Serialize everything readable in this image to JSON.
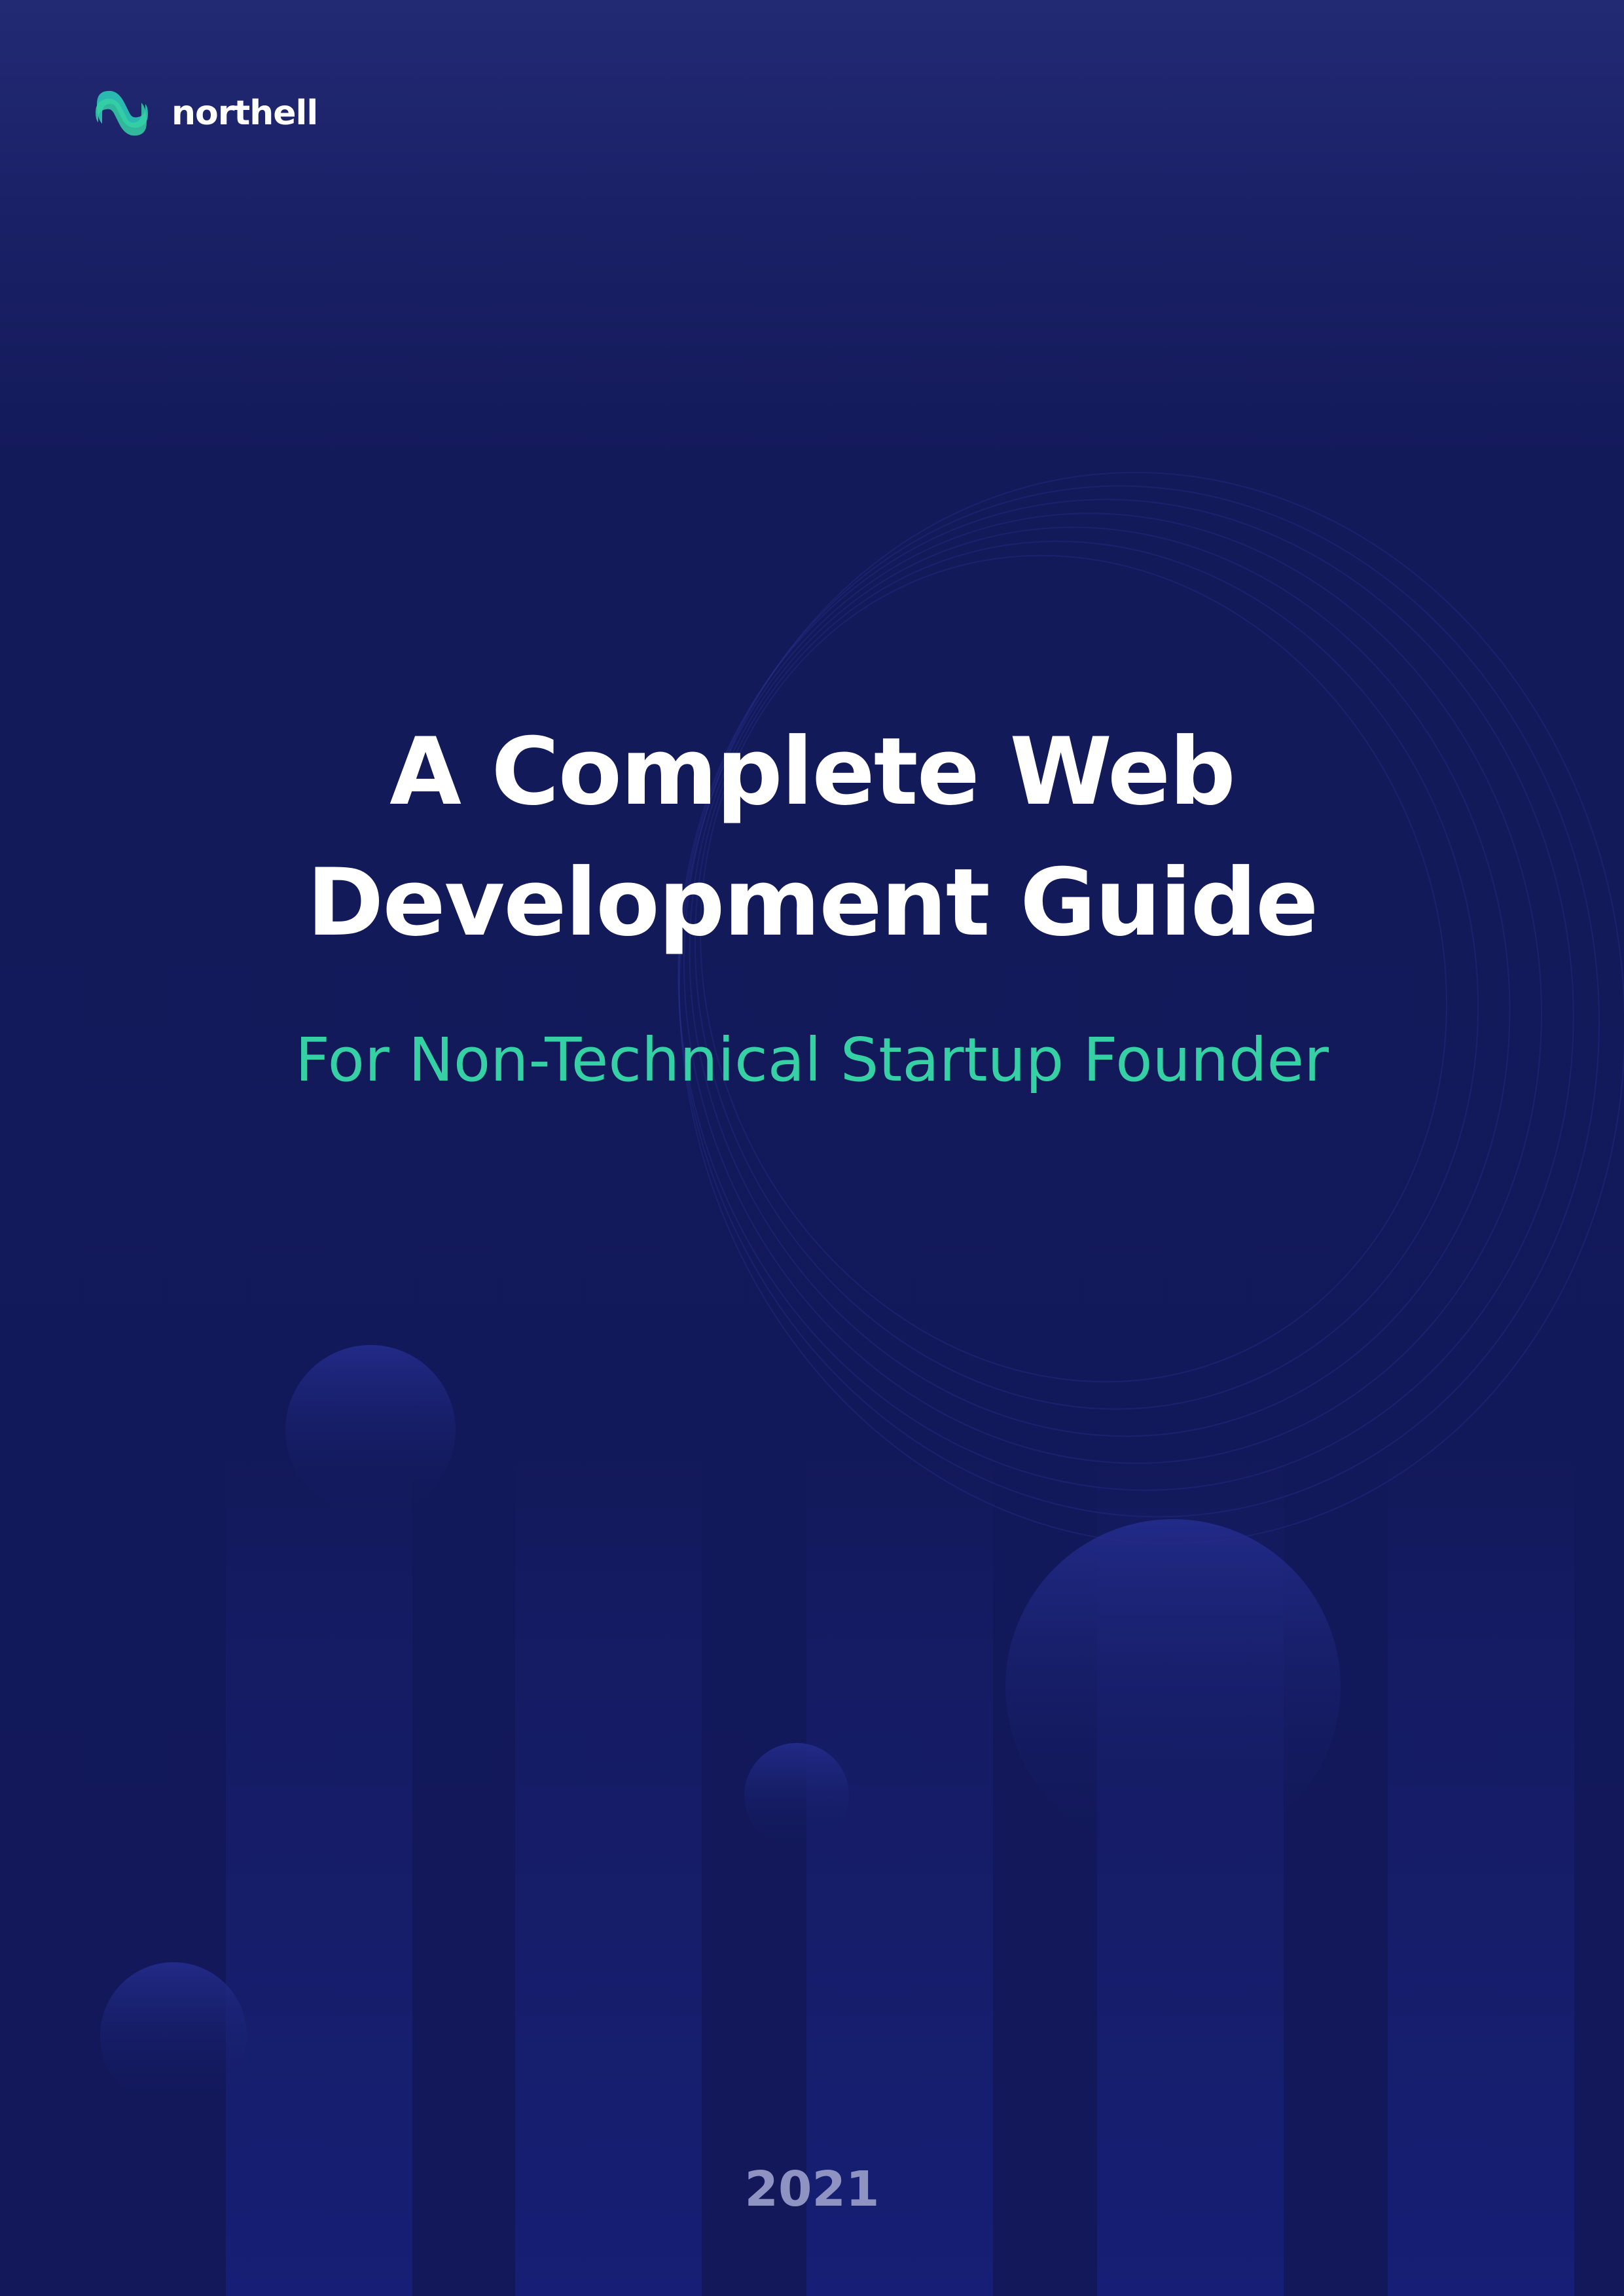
{
  "brand": {
    "name": "northell",
    "logo_icon": "northell-logo-icon",
    "accent_color": "#35d1a5"
  },
  "cover": {
    "title_line_1": "A Complete Web",
    "title_line_2": "Development Guide",
    "subtitle": "For Non-Technical Startup Founder",
    "year": "2021"
  },
  "colors": {
    "background": "#12185a",
    "background_top": "#222a74",
    "title": "#ffffff",
    "subtitle": "#35d1a5",
    "year": "#8e93c2"
  }
}
